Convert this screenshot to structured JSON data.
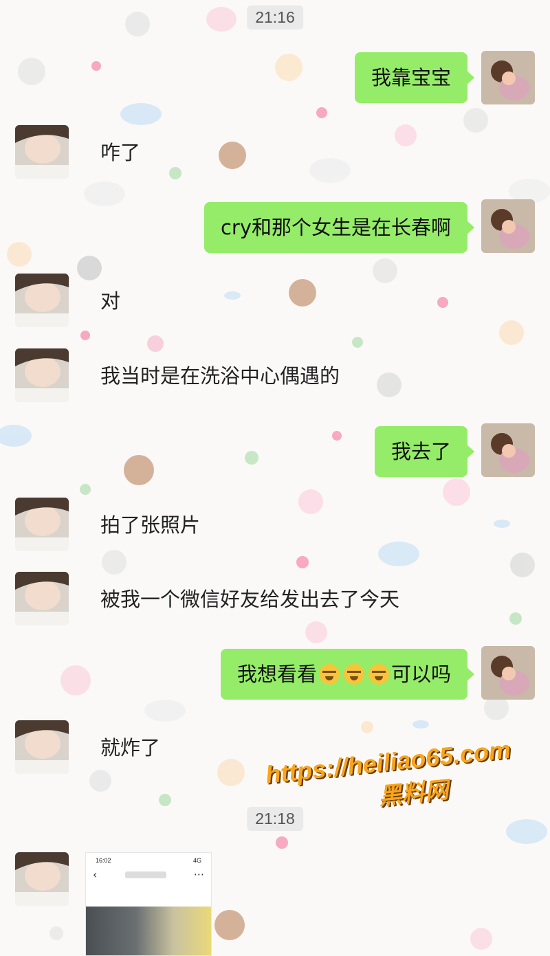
{
  "timestamps": [
    "21:16",
    "21:18"
  ],
  "messages": [
    {
      "from": "me",
      "text": "我靠宝宝"
    },
    {
      "from": "her",
      "text": "咋了"
    },
    {
      "from": "me",
      "text": "cry和那个女生是在长春啊"
    },
    {
      "from": "her",
      "text": "对"
    },
    {
      "from": "her",
      "text": "我当时是在洗浴中心偶遇的"
    },
    {
      "from": "me",
      "text": "我去了"
    },
    {
      "from": "her",
      "text": "拍了张照片"
    },
    {
      "from": "her",
      "text": "被我一个微信好友给发出去了今天"
    },
    {
      "from": "me",
      "text_before": "我想看看",
      "emojis": [
        "crying-face",
        "crying-face",
        "crying-face"
      ],
      "text_after": "可以吗"
    },
    {
      "from": "her",
      "text": "就炸了"
    }
  ],
  "image_message": {
    "status_time": "16:02",
    "status_right": "4G",
    "back": "‹",
    "more": "···"
  },
  "watermark": {
    "url": "https://heiliao65.com",
    "name": "黑料网"
  },
  "colors": {
    "my_bubble": "#95ec69",
    "background": "#fbf9f7",
    "watermark": "#f7a51c"
  }
}
